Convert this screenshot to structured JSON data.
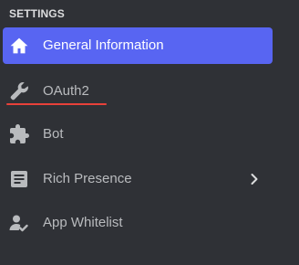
{
  "sidebar": {
    "section_title": "SETTINGS",
    "items": [
      {
        "label": "General Information",
        "icon": "home-icon",
        "active": true
      },
      {
        "label": "OAuth2",
        "icon": "wrench-icon",
        "active": false
      },
      {
        "label": "Bot",
        "icon": "puzzle-icon",
        "active": false
      },
      {
        "label": "Rich Presence",
        "icon": "document-icon",
        "active": false,
        "expandable": true
      },
      {
        "label": "App Whitelist",
        "icon": "user-check-icon",
        "active": false
      }
    ]
  },
  "colors": {
    "background": "#2f3136",
    "active_background": "#5865f2",
    "text": "#b9bbbe",
    "active_text": "#ffffff",
    "annotation_underline": "#e8413a"
  }
}
